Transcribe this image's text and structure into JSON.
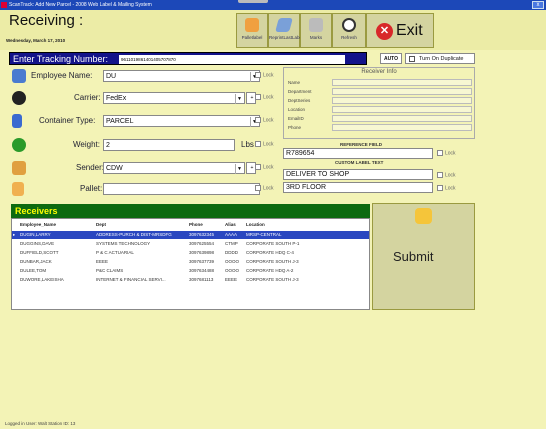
{
  "window": {
    "title": "ScanTrack: Add New Parcel - 2008 Web Label & Mailing System",
    "close_label": "x"
  },
  "header": {
    "app_title": "Receiving :",
    "date": "Wednesday, March 17, 2010"
  },
  "toolbar": [
    {
      "label": "Palletlabel",
      "icon": "pallet-icon",
      "color": "#f0a040"
    },
    {
      "label": "ReprintLastLabel",
      "icon": "reprint-icon",
      "color": "#7aa0d8"
    },
    {
      "label": "Marks",
      "icon": "marks-icon",
      "color": "#bbbbbb"
    },
    {
      "label": "Refresh",
      "icon": "refresh-icon",
      "color": "#ffffff"
    }
  ],
  "exit_label": "Exit",
  "tracking": {
    "label": "Enter Tracking Number:",
    "value": "9611019861401405707870"
  },
  "auto_label": "AUTO",
  "dup_label": "Turn On Duplicate",
  "fields": {
    "employee": {
      "label": "Employee Name:",
      "value": "DU"
    },
    "carrier": {
      "label": "Carrier:",
      "value": "FedEx"
    },
    "container": {
      "label": "Container Type:",
      "value": "PARCEL"
    },
    "weight": {
      "label": "Weight:",
      "value": "2",
      "unit": "Lbs"
    },
    "sender": {
      "label": "Sender:",
      "value": "CDW"
    },
    "pallet": {
      "label": "Pallet:",
      "value": ""
    }
  },
  "lock_label": "Lock",
  "receiver_info": {
    "title": "Receiver Info",
    "rows": [
      "Name",
      "Department",
      "DeptSeries",
      "Location",
      "EmailID",
      "Phone"
    ]
  },
  "reference": {
    "header": "REFERENCE FIELD",
    "value": "R789654"
  },
  "custom": {
    "header": "CUSTOM LABEL TEXT",
    "line1": "DELIVER TO SHOP",
    "line2": "3RD FLOOR"
  },
  "receivers": {
    "title": "Receivers",
    "columns": [
      "Employee_Name",
      "Dept",
      "Phone",
      "Alias",
      "Location"
    ],
    "rows": [
      [
        "DUGIN,LARRY",
        "ADDRESS-PURCH & DIST-MRSDFG",
        "3097632345",
        "AAAA",
        "MRSP-CENTRAL"
      ],
      [
        "DUGGINS,DAVE",
        "SYSTEMS TECHNOLOGY",
        "3097625554",
        "CTMP",
        "CORPORATE SOUTH P-1"
      ],
      [
        "DUFFIELD,SCOTT",
        "P & C ACTUARIAL",
        "3097639898",
        "DDDD",
        "CORPORATE HDQ C-4"
      ],
      [
        "DUNBAR,JACK",
        "EEEE",
        "3097637739",
        "OOOO",
        "CORPORATE SOUTH J-3"
      ],
      [
        "DULEE,TOM",
        "P&C CLAIMS",
        "3097634488",
        "OOOO",
        "CORPORATE HDQ A-2"
      ],
      [
        "DUWORE,LAKEISHA",
        "INTERNET & FINANCIAL SERVI...",
        "3097681113",
        "EEEE",
        "CORPORATE SOUTH J-3"
      ]
    ]
  },
  "submit_label": "Submit",
  "status": "Logged in User: Walt  Station ID: 13"
}
